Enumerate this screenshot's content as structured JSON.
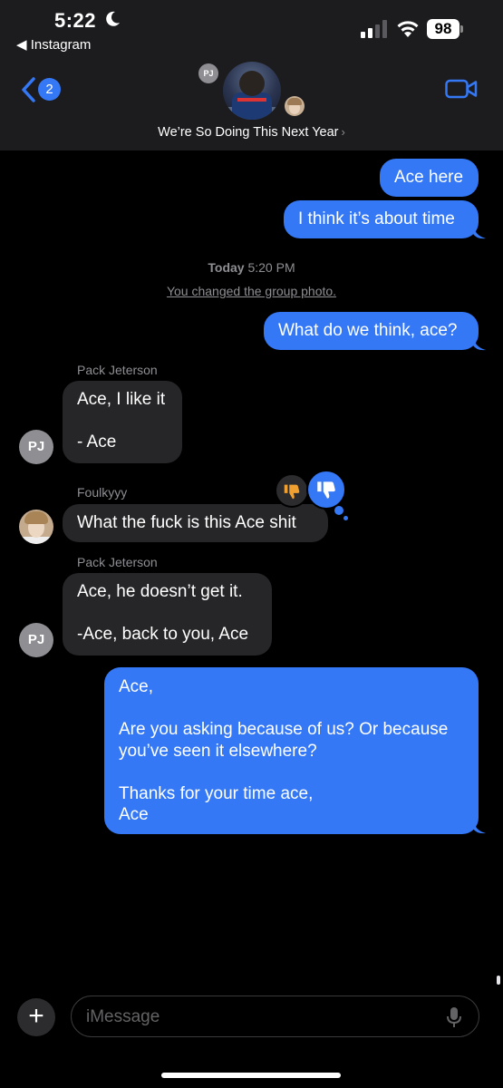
{
  "status_bar": {
    "time": "5:22",
    "back_app": "◀ Instagram",
    "battery": "98"
  },
  "header": {
    "unread_count": "2",
    "mini_avatar_initials": "PJ",
    "group_name": "We’re So Doing This Next Year",
    "group_name_chevron": "›"
  },
  "messages": [
    {
      "direction": "outgoing",
      "text": "Ace here"
    },
    {
      "direction": "outgoing",
      "text": "I think it’s about time"
    },
    {
      "direction": "outgoing",
      "text": "What do we think, ace?"
    },
    {
      "direction": "incoming",
      "sender": "Pack Jeterson",
      "avatar": "PJ",
      "text": "Ace, I like it\n\n- Ace"
    },
    {
      "direction": "incoming",
      "sender": "Foulkyyy",
      "text": "What the fuck is this Ace shit",
      "reactions": [
        "thumbs-down",
        "thumbs-down"
      ]
    },
    {
      "direction": "incoming",
      "sender": "Pack Jeterson",
      "avatar": "PJ",
      "text": "Ace, he doesn’t get it.\n\n-Ace, back to you, Ace"
    },
    {
      "direction": "outgoing",
      "text": "Ace,\n\nAre you asking because of us? Or because\nyou’ve seen it elsewhere?\n\nThanks for your time ace,\nAce"
    }
  ],
  "timestamp": {
    "day": "Today",
    "time": "5:20 PM"
  },
  "notice": "You changed the group photo.",
  "input": {
    "plus_label": "+",
    "placeholder": "iMessage"
  },
  "colors": {
    "outgoing_bubble": "#3478f6",
    "incoming_bubble": "#262628",
    "header_bg": "#1c1c1e",
    "reaction_thumb": "#f0a030"
  },
  "icons": [
    "moon-icon",
    "signal-icon",
    "wifi-icon",
    "battery-icon",
    "back-chevron-icon",
    "video-camera-icon",
    "thumbs-down-icon",
    "plus-icon",
    "microphone-icon"
  ]
}
